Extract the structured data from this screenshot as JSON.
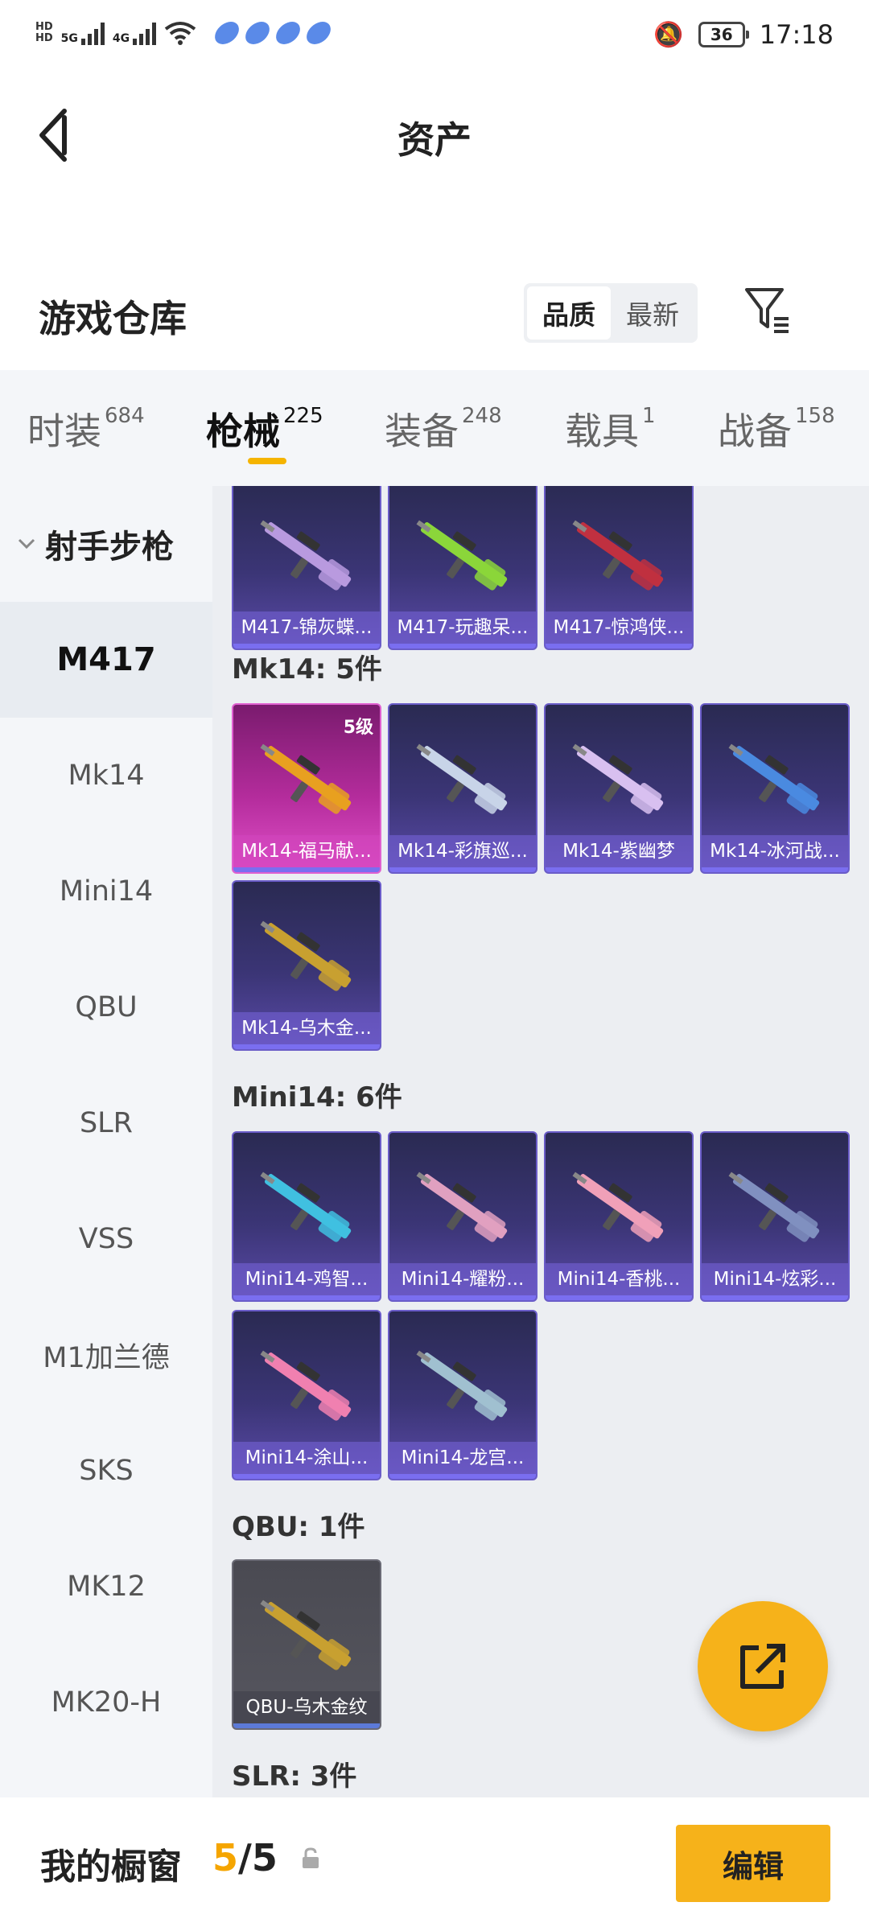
{
  "status_bar": {
    "time": "17:18",
    "battery": "36",
    "network1": "5G",
    "network2": "4G"
  },
  "nav": {
    "title": "资产"
  },
  "warehouse": {
    "title": "游戏仓库",
    "sort_options": [
      "品质",
      "最新"
    ],
    "active_sort": "品质"
  },
  "tabs": [
    {
      "label": "时装",
      "count": "684"
    },
    {
      "label": "枪械",
      "count": "225",
      "active": true
    },
    {
      "label": "装备",
      "count": "248"
    },
    {
      "label": "载具",
      "count": "1"
    },
    {
      "label": "战备",
      "count": "158"
    }
  ],
  "sidebar": {
    "group_label": "射手步枪",
    "items": [
      "M417",
      "Mk14",
      "Mini14",
      "QBU",
      "SLR",
      "VSS",
      "M1加兰德",
      "SKS",
      "MK12",
      "MK20-H"
    ],
    "active": "M417"
  },
  "sections": [
    {
      "title": "",
      "items": [
        {
          "name": "M417-锦灰蝶...",
          "rarity": "purple",
          "color": "#b89adf"
        },
        {
          "name": "M417-玩趣呆...",
          "rarity": "purple",
          "color": "#8bd63a"
        },
        {
          "name": "M417-惊鸿侠...",
          "rarity": "purple",
          "color": "#c03040"
        }
      ]
    },
    {
      "title": "Mk14: 5件",
      "items": [
        {
          "name": "Mk14-福马献...",
          "rarity": "gold",
          "level": "5级",
          "color": "#e8a020"
        },
        {
          "name": "Mk14-彩旗巡...",
          "rarity": "purple",
          "color": "#c8d4e8"
        },
        {
          "name": "Mk14-紫幽梦",
          "rarity": "purple",
          "color": "#d8c0f0"
        },
        {
          "name": "Mk14-冰河战...",
          "rarity": "purple",
          "color": "#4a8ae0"
        },
        {
          "name": "Mk14-乌木金...",
          "rarity": "purple",
          "color": "#c8a030"
        }
      ]
    },
    {
      "title": "Mini14: 6件",
      "items": [
        {
          "name": "Mini14-鸡智...",
          "rarity": "purple",
          "color": "#40c0e0"
        },
        {
          "name": "Mini14-耀粉...",
          "rarity": "purple",
          "color": "#e0a0c0"
        },
        {
          "name": "Mini14-香桃...",
          "rarity": "purple",
          "color": "#f0a0b8"
        },
        {
          "name": "Mini14-炫彩...",
          "rarity": "purple",
          "color": "#8090c0"
        },
        {
          "name": "Mini14-涂山...",
          "rarity": "purple",
          "color": "#f080b0"
        },
        {
          "name": "Mini14-龙宫...",
          "rarity": "purple",
          "color": "#a0c0d0"
        }
      ]
    },
    {
      "title": "QBU: 1件",
      "items": [
        {
          "name": "QBU-乌木金纹",
          "rarity": "grey",
          "color": "#c8a030"
        }
      ]
    },
    {
      "title": "SLR: 3件",
      "items": []
    }
  ],
  "bottom": {
    "showcase_label": "我的橱窗",
    "current": "5",
    "separator": "/",
    "max": "5",
    "edit_label": "编辑"
  },
  "colors": {
    "accent": "#f6b21a",
    "count_highlight": "#f5a500"
  }
}
